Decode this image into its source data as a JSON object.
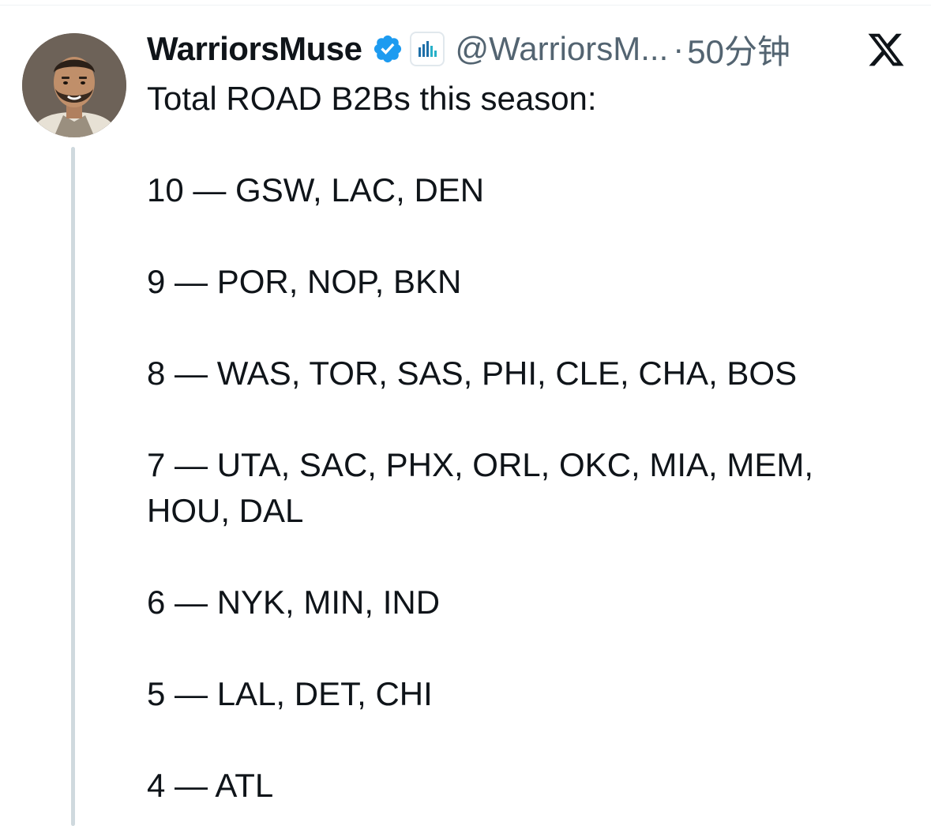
{
  "tweet": {
    "display_name": "WarriorsMuse",
    "handle": "@WarriorsM...",
    "separator": "·",
    "time": "50分钟",
    "lines": [
      "Total ROAD B2Bs this season:",
      "",
      "10 — GSW, LAC, DEN",
      "",
      "9 — POR, NOP, BKN",
      "",
      "8 — WAS, TOR, SAS, PHI, CLE, CHA, BOS",
      "",
      "7 — UTA, SAC, PHX, ORL, OKC, MIA, MEM,",
      "HOU, DAL",
      "",
      "6 — NYK, MIN, IND",
      "",
      "5 — LAL, DET, CHI",
      "",
      "4 — ATL"
    ]
  },
  "icons": {
    "verified": "verified-badge-icon",
    "affiliate": "affiliate-badge-icon",
    "brand": "x-logo-icon"
  },
  "colors": {
    "text": "#0f1419",
    "secondary": "#536471",
    "verified": "#1d9bf0",
    "thread_line": "#cfd9de"
  }
}
